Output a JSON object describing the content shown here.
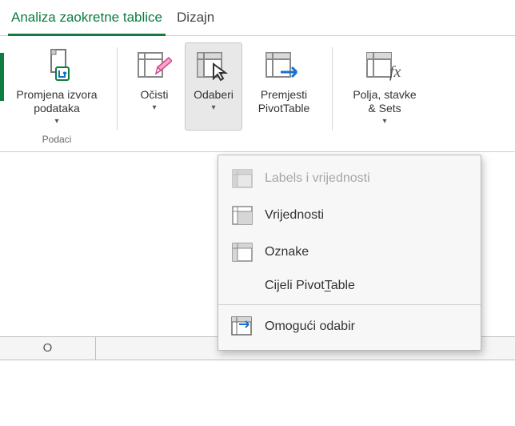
{
  "tabs": {
    "analyze": "Analiza zaokretne tablice",
    "design": "Dizajn"
  },
  "ribbon": {
    "changeSource": {
      "line1": "Promjena izvora",
      "line2": "podataka"
    },
    "groupData": "Podaci",
    "clear": "Očisti",
    "select": "Odaberi",
    "move": {
      "line1": "Premjesti",
      "line2": "PivotTable"
    },
    "fields": {
      "line1": "Polja, stavke",
      "line2": "& Sets"
    }
  },
  "menu": {
    "labelsValues": {
      "prefix": "Labels",
      "suffix": " i vrijednosti"
    },
    "values": "Vrijednosti",
    "labels": "Oznake",
    "entire": {
      "prefix": "Cijeli  Pivot",
      "hotkey": "T",
      "suffix": "able"
    },
    "enable": "Omogući odabir"
  },
  "columns": {
    "o": "O"
  }
}
